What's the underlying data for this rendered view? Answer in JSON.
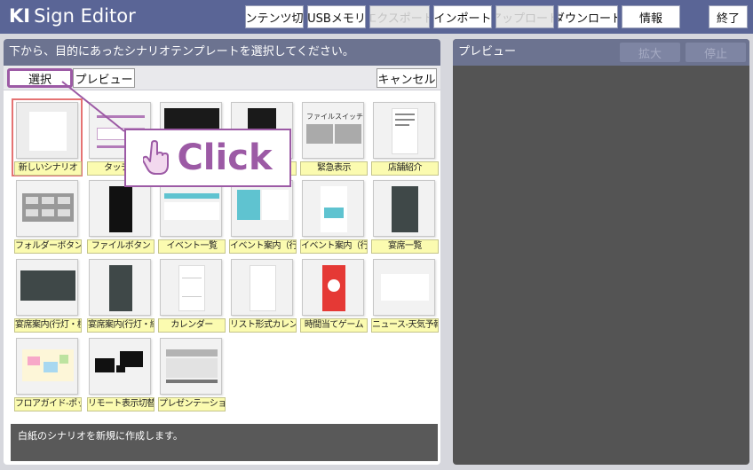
{
  "app": {
    "logo_ki": "KI",
    "logo_rest": "Sign Editor"
  },
  "toolbar": {
    "content_switch": "コンテンツ切替",
    "usb_memory": "USBメモリ",
    "export": "エクスポート",
    "import": "インポート",
    "upload": "アップロード",
    "download": "ダウンロード",
    "info": "情報",
    "exit": "終了"
  },
  "left_panel": {
    "header": "下から、目的にあったシナリオテンプレートを選択してください。",
    "select_label": "選択",
    "preview_label": "プレビュー",
    "cancel_label": "キャンセル",
    "description": "白紙のシナリオを新規に作成します。"
  },
  "templates": [
    {
      "label": "新しいシナリオ",
      "selected": true
    },
    {
      "label": "タッチ画"
    },
    {
      "label": ""
    },
    {
      "label": ""
    },
    {
      "label": "緊急表示",
      "thumb_text": "ファイルスイッチ"
    },
    {
      "label": "店舗紹介"
    },
    {
      "label": "フォルダーボタン"
    },
    {
      "label": "ファイルボタン"
    },
    {
      "label": "イベント一覧"
    },
    {
      "label": "イベント案内（行灯・横）"
    },
    {
      "label": "イベント案内（行灯・縦）"
    },
    {
      "label": "宴席一覧"
    },
    {
      "label": "宴席案内(行灯・横)"
    },
    {
      "label": "宴席案内(行灯・縦)"
    },
    {
      "label": "カレンダー"
    },
    {
      "label": "リスト形式カレンダー"
    },
    {
      "label": "時間当てゲーム"
    },
    {
      "label": "ニュース-天気予報"
    },
    {
      "label": "フロアガイド-ポップアップ"
    },
    {
      "label": "リモート表示切替"
    },
    {
      "label": "プレゼンテーション"
    }
  ],
  "right_panel": {
    "header": "プレビュー",
    "zoom_label": "拡大",
    "stop_label": "停止"
  },
  "overlay": {
    "click_text": "Click"
  },
  "colors": {
    "topbar": "#5a6596",
    "panel_header": "#6c7390",
    "accent_purple": "#9c5aa5",
    "label_yellow": "#fbfbb0",
    "selected_border": "#e57373"
  }
}
